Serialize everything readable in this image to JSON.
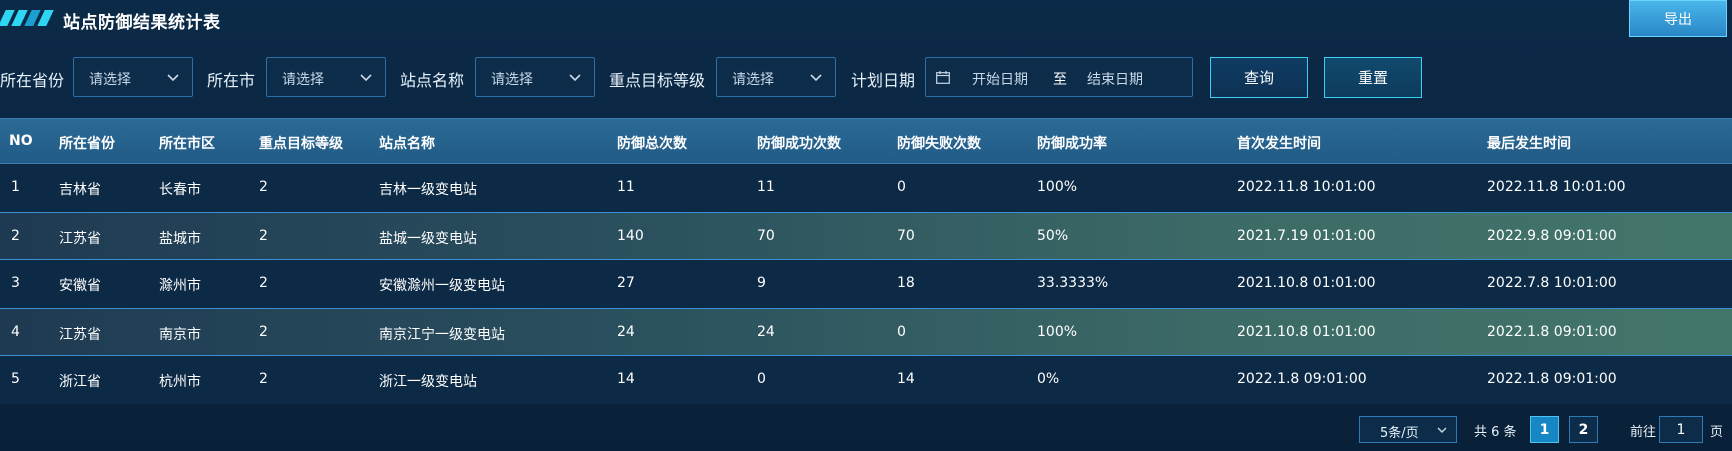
{
  "header": {
    "title": "站点防御结果统计表",
    "export_label": "导出"
  },
  "filters": {
    "province_label": "所在省份",
    "province_placeholder": "请选择",
    "city_label": "所在市",
    "city_placeholder": "请选择",
    "station_label": "站点名称",
    "station_placeholder": "请选择",
    "level_label": "重点目标等级",
    "level_placeholder": "请选择",
    "date_label": "计划日期",
    "date_start_placeholder": "开始日期",
    "date_separator": "至",
    "date_end_placeholder": "结束日期",
    "query_label": "查询",
    "reset_label": "重置"
  },
  "table": {
    "columns": [
      "NO",
      "所在省份",
      "所在市区",
      "重点目标等级",
      "站点名称",
      "防御总次数",
      "防御成功次数",
      "防御失败次数",
      "防御成功率",
      "首次发生时间",
      "最后发生时间"
    ],
    "rows": [
      [
        "1",
        "吉林省",
        "长春市",
        "2",
        "吉林一级变电站",
        "11",
        "11",
        "0",
        "100%",
        "2022.11.8 10:01:00",
        "2022.11.8 10:01:00"
      ],
      [
        "2",
        "江苏省",
        "盐城市",
        "2",
        "盐城一级变电站",
        "140",
        "70",
        "70",
        "50%",
        "2021.7.19 01:01:00",
        "2022.9.8 09:01:00"
      ],
      [
        "3",
        "安徽省",
        "滁州市",
        "2",
        "安徽滁州一级变电站",
        "27",
        "9",
        "18",
        "33.3333%",
        "2021.10.8 01:01:00",
        "2022.7.8 10:01:00"
      ],
      [
        "4",
        "江苏省",
        "南京市",
        "2",
        "南京江宁一级变电站",
        "24",
        "24",
        "0",
        "100%",
        "2021.10.8 01:01:00",
        "2022.1.8 09:01:00"
      ],
      [
        "5",
        "浙江省",
        "杭州市",
        "2",
        "浙江一级变电站",
        "14",
        "0",
        "14",
        "0%",
        "2022.1.8 09:01:00",
        "2022.1.8 09:01:00"
      ]
    ]
  },
  "pagination": {
    "page_size": "5条/页",
    "total": "共 6 条",
    "pages": [
      "1",
      "2"
    ],
    "current_page": "1",
    "goto_label": "前往",
    "goto_value": "1",
    "goto_suffix": "页"
  },
  "colors": {
    "accent": "#2dd6f2",
    "header_bg": "#215b86",
    "highlight_row": "#3c6a66",
    "page_bg": "#0a2540"
  }
}
